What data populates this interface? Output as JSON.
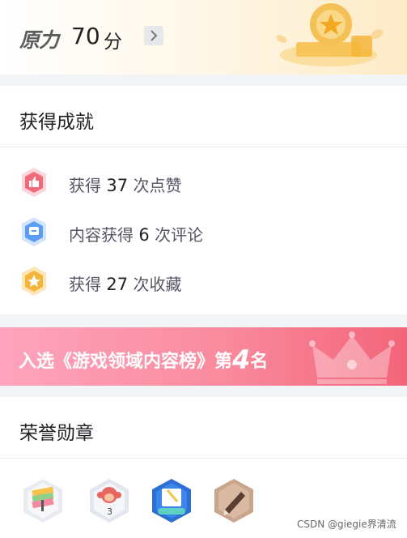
{
  "force": {
    "logo": "原力",
    "score": "70",
    "unit": "分"
  },
  "achievements": {
    "title": "获得成就",
    "items": [
      {
        "prefix": "获得 ",
        "value": "37",
        "suffix": " 次点赞",
        "icon": "thumbs-up-icon",
        "color": "#f06a7a"
      },
      {
        "prefix": "内容获得 ",
        "value": "6",
        "suffix": " 次评论",
        "icon": "comment-icon",
        "color": "#5b9cf5"
      },
      {
        "prefix": "获得 ",
        "value": "27",
        "suffix": " 次收藏",
        "icon": "star-icon",
        "color": "#f5b53a"
      }
    ]
  },
  "rank": {
    "prefix": "入选《游戏领域内容榜》第",
    "number": "4",
    "suffix": "名"
  },
  "honor": {
    "title": "荣誉勋章",
    "badges": [
      {
        "icon": "badge-streak-icon"
      },
      {
        "icon": "badge-monkey-icon"
      },
      {
        "icon": "badge-creation-icon"
      },
      {
        "icon": "badge-pencil-icon"
      }
    ]
  },
  "watermark": "CSDN @giegie界清流"
}
